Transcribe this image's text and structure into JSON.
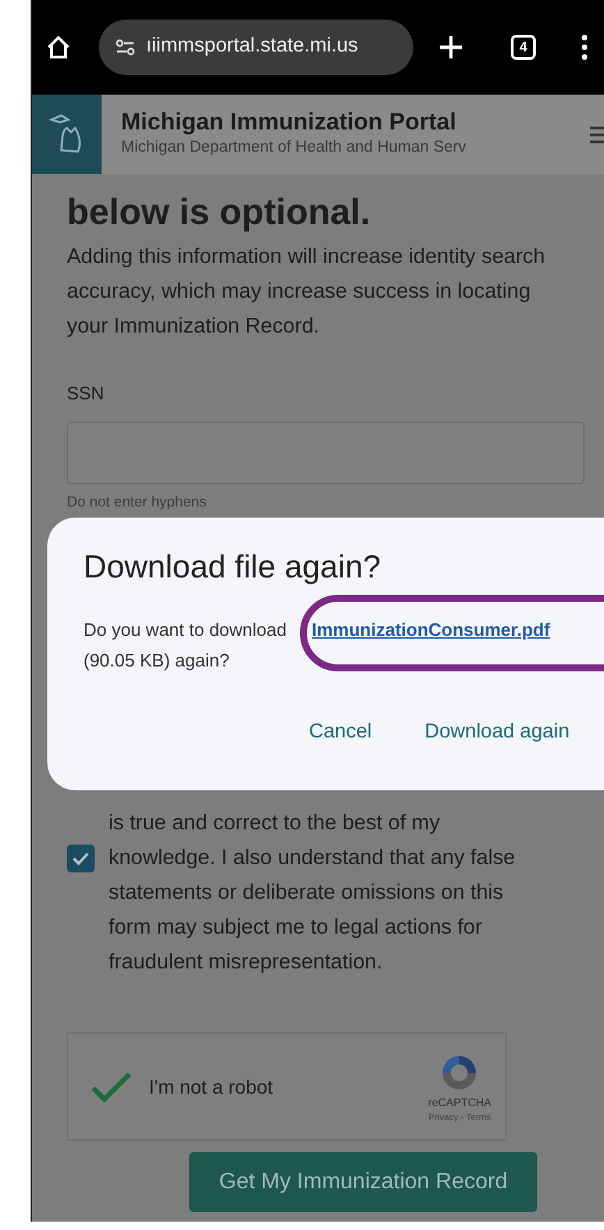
{
  "browser": {
    "url": "ıiimmsportal.state.mi.us",
    "tab_count": "4"
  },
  "header": {
    "title": "Michigan Immunization Portal",
    "subtitle": "Michigan Department of Health and Human Serv"
  },
  "form": {
    "heading": "below is optional.",
    "intro": "Adding this information will increase identity search accuracy, which may increase success in locating your Immunization Record.",
    "ssn": {
      "label": "SSN",
      "hint": "Do not enter hyphens"
    },
    "attestation": {
      "text": "is true and correct to the best of my knowledge. I also understand that any false statements or deliberate omissions on this form may subject me to legal actions for fraudulent misrepresentation.",
      "checked": true
    },
    "captcha": {
      "label": "I'm not a robot",
      "checked": true,
      "brand": "reCAPTCHA",
      "links": "Privacy - Terms"
    },
    "submit": "Get My Immunization Record"
  },
  "dialog": {
    "title": "Download file again?",
    "text_before": "Do you want to download",
    "file_link": "ImmunizationConsumer.pdf",
    "text_after": "(90.05 KB) again?",
    "buttons": [
      {
        "label": "Cancel"
      },
      {
        "label": "Download again"
      }
    ]
  }
}
